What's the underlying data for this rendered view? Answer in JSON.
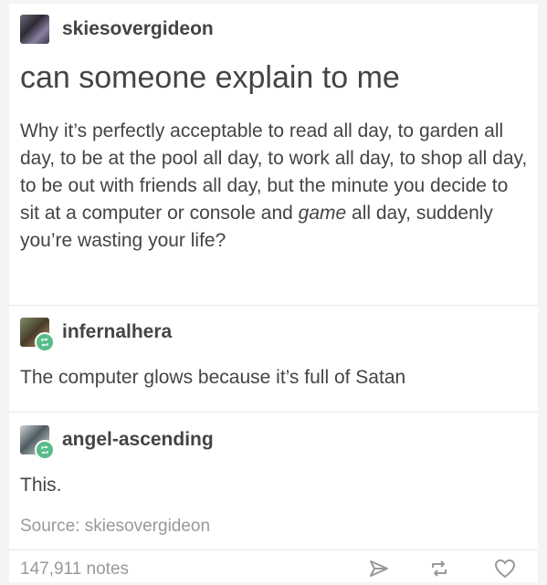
{
  "original_post": {
    "username": "skiesovergideon",
    "title": "can someone explain to me",
    "body": "Why it’s perfectly acceptable to read all day, to garden all day, to be at the pool all day, to work all day, to shop all day, to be out with friends all day, but the minute you decide to sit at a computer or console and game all day, suddenly you’re wasting your life?"
  },
  "replies": [
    {
      "username": "infernalhera",
      "text": "The computer glows because it’s full of Satan"
    },
    {
      "username": "angel-ascending",
      "text": "This."
    }
  ],
  "footer": {
    "source": "Source: skiesovergideon",
    "notes": "147,911 notes"
  },
  "icons": {
    "share": "share-icon",
    "reblog": "reblog-icon",
    "like": "heart-icon"
  },
  "colors": {
    "reblog_badge": "#56bc8a"
  }
}
